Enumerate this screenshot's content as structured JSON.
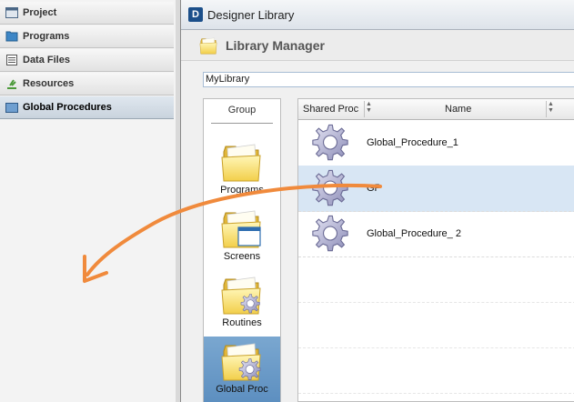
{
  "nav": {
    "items": [
      {
        "label": "Project",
        "icon": "project-icon"
      },
      {
        "label": "Programs",
        "icon": "programs-icon"
      },
      {
        "label": "Data Files",
        "icon": "data-files-icon"
      },
      {
        "label": "Resources",
        "icon": "resources-icon"
      },
      {
        "label": "Global Procedures",
        "icon": "global-procedures-icon",
        "selected": true
      }
    ]
  },
  "window": {
    "app_icon_text": "D",
    "title": "Designer Library"
  },
  "library_manager": {
    "title": "Library Manager",
    "library_value": "MyLibrary"
  },
  "group": {
    "header": "Group",
    "items": [
      {
        "label": "Programs",
        "icon": "folder-icon"
      },
      {
        "label": "Screens",
        "icon": "folder-screen-icon"
      },
      {
        "label": "Routines",
        "icon": "folder-gear-icon"
      },
      {
        "label": "Global Proc",
        "icon": "folder-procedure-icon",
        "selected": true
      }
    ]
  },
  "grid": {
    "columns": [
      "Shared Proc",
      "Name"
    ],
    "rows": [
      {
        "name": "Global_Procedure_1",
        "icon": "gear-icon"
      },
      {
        "name": "GP",
        "icon": "gear-icon",
        "selected": true
      },
      {
        "name": "Global_Procedure_ 2",
        "icon": "gear-icon"
      }
    ]
  },
  "colors": {
    "accent_arrow": "#f08a3c",
    "selected_group": "#6b9bc8",
    "selected_row": "#d8e6f4"
  }
}
